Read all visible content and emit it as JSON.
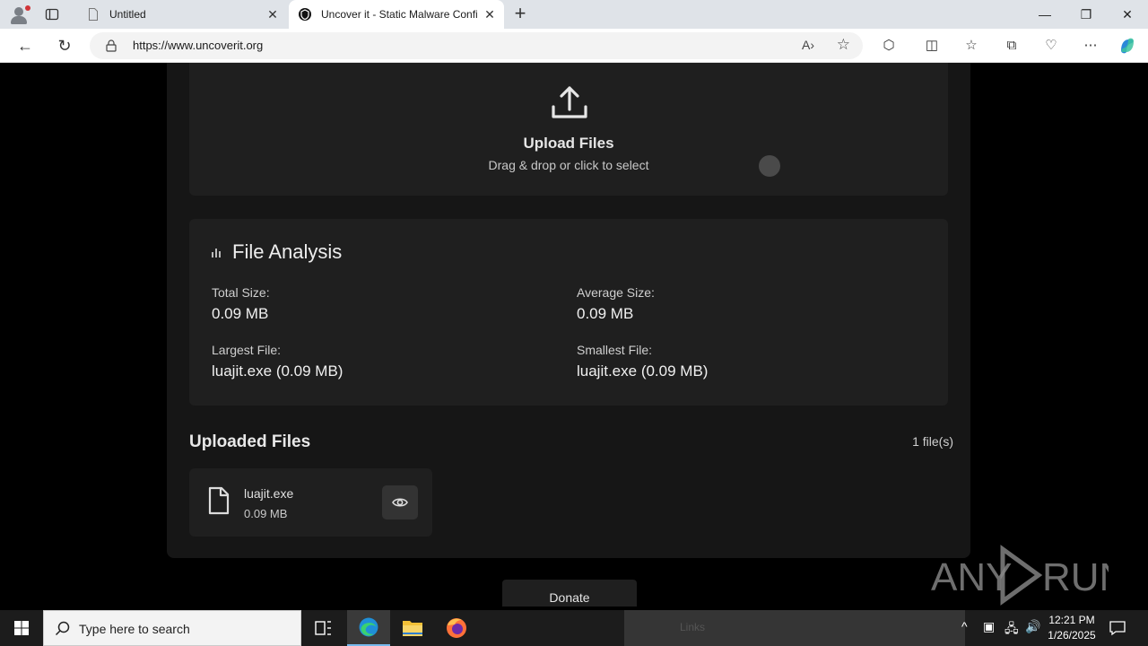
{
  "browser": {
    "tabs": [
      {
        "title": "Untitled"
      },
      {
        "title": "Uncover it - Static Malware Confi"
      }
    ],
    "url": "https://www.uncoverit.org"
  },
  "upload": {
    "title": "Upload Files",
    "subtitle": "Drag & drop or click to select"
  },
  "analysis": {
    "title": "File Analysis",
    "stats": [
      {
        "label": "Total Size:",
        "value": "0.09 MB"
      },
      {
        "label": "Average Size:",
        "value": "0.09 MB"
      },
      {
        "label": "Largest File:",
        "value": "luajit.exe (0.09 MB)"
      },
      {
        "label": "Smallest File:",
        "value": "luajit.exe (0.09 MB)"
      }
    ]
  },
  "uploaded": {
    "title": "Uploaded Files",
    "count": "1 file(s)",
    "files": [
      {
        "name": "luajit.exe",
        "size": "0.09 MB"
      }
    ]
  },
  "donate_label": "Donate",
  "watermark": "ANY RUN",
  "taskbar": {
    "search_placeholder": "Type here to search",
    "behind_window_text": "Links",
    "time": "12:21 PM",
    "date": "1/26/2025"
  },
  "colors": {
    "page_bg": "#000000",
    "panel_bg": "#1f1f1f",
    "accent_taskbar": "#76b9ed"
  }
}
